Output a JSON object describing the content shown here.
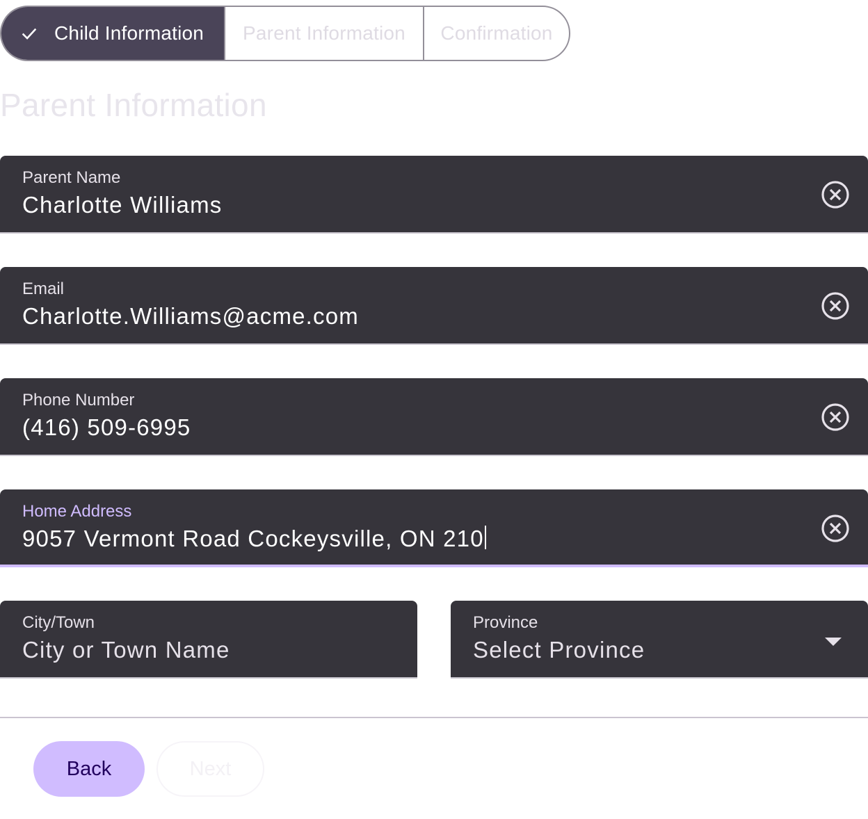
{
  "stepper": {
    "steps": [
      {
        "label": "Child Information",
        "state": "completed"
      },
      {
        "label": "Parent Information",
        "state": "inactive"
      },
      {
        "label": "Confirmation",
        "state": "inactive"
      }
    ]
  },
  "page_title": "Parent Information",
  "fields": {
    "parent_name": {
      "label": "Parent Name",
      "value": "Charlotte Williams"
    },
    "email": {
      "label": "Email",
      "value": "Charlotte.Williams@acme.com"
    },
    "phone": {
      "label": "Phone Number",
      "value": "(416) 509-6995"
    },
    "home_address": {
      "label": "Home Address",
      "value": "9057 Vermont Road Cockeysville, ON 210"
    },
    "city": {
      "label": "City/Town",
      "placeholder": "City or Town Name"
    },
    "province": {
      "label": "Province",
      "placeholder": "Select Province"
    }
  },
  "buttons": {
    "back": "Back",
    "next": "Next"
  },
  "colors": {
    "primary": "#d0bcff",
    "field_bg": "#36343b",
    "step_active_bg": "#4a4458"
  },
  "icons": {
    "check": "check-icon",
    "clear": "clear-circle-icon",
    "dropdown": "dropdown-arrow-icon"
  }
}
